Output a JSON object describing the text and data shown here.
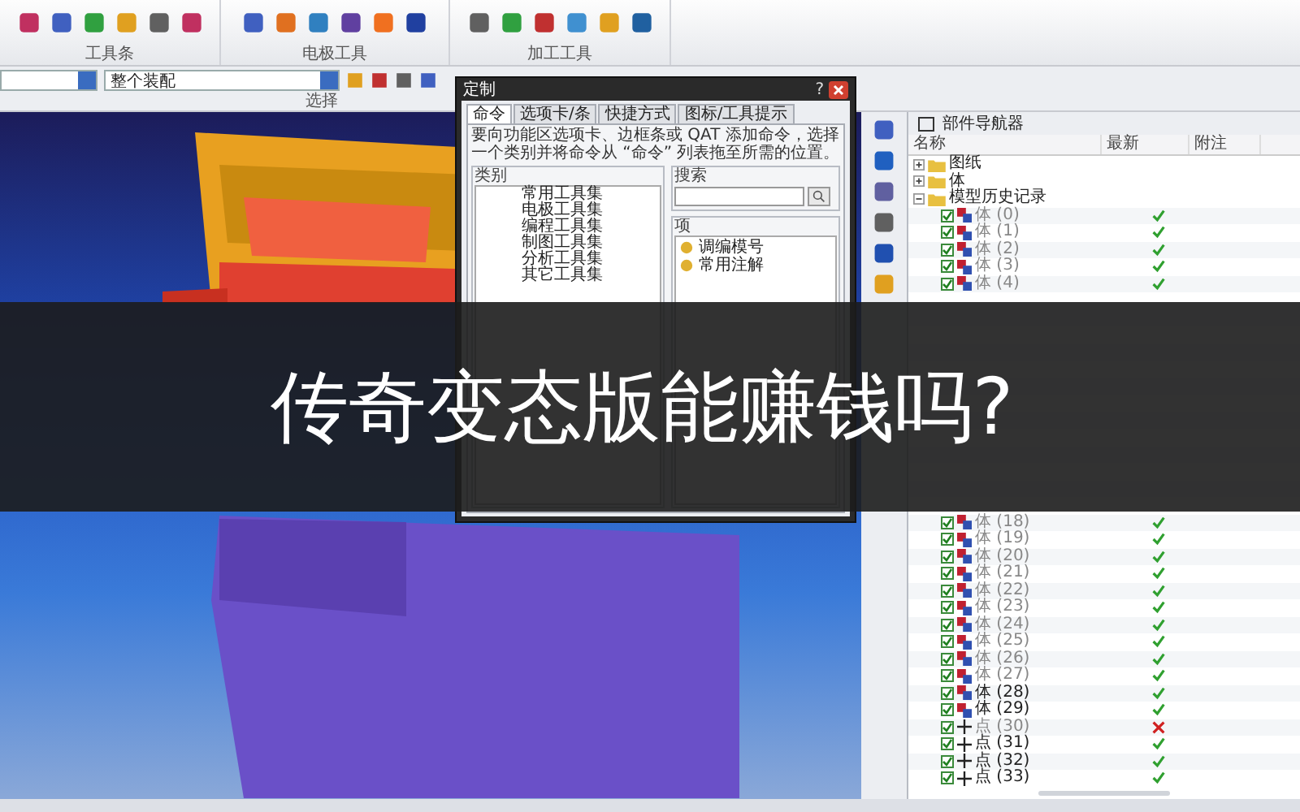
{
  "ribbon": {
    "groups": [
      {
        "label": "工具条"
      },
      {
        "label": "电极工具"
      },
      {
        "label": "加工工具"
      }
    ]
  },
  "selection_bar": {
    "scope": "整个装配",
    "label": "选择"
  },
  "dialog": {
    "title": "定制",
    "help": "?",
    "tabs": [
      {
        "label": "命令",
        "selected": true
      },
      {
        "label": "选项卡/条",
        "selected": false
      },
      {
        "label": "快捷方式",
        "selected": false
      },
      {
        "label": "图标/工具提示",
        "selected": false
      }
    ],
    "description": "要向功能区选项卡、边框条或 QAT 添加命令，选择一个类别并将命令从 “命令” 列表拖至所需的位置。",
    "category": {
      "title": "类别",
      "items": [
        "常用工具集",
        "电极工具集",
        "编程工具集",
        "制图工具集",
        "分析工具集",
        "其它工具集"
      ]
    },
    "search": {
      "title": "搜索"
    },
    "items_group": {
      "title": "项",
      "items": [
        "调编模号",
        "常用注解"
      ]
    }
  },
  "navigator": {
    "title": "部件导航器",
    "columns": [
      "名称",
      "最新",
      "附注"
    ],
    "tree": [
      {
        "label": "图纸",
        "expanded": false
      },
      {
        "label": "体",
        "expanded": false
      },
      {
        "label": "模型历史记录",
        "expanded": true,
        "children": [
          {
            "kind": "body",
            "label": "体 (0)",
            "checked": true,
            "latest": true,
            "greyed": true,
            "selected": false
          },
          {
            "kind": "body",
            "label": "体 (1)",
            "checked": true,
            "latest": true,
            "greyed": true,
            "selected": false
          },
          {
            "kind": "body",
            "label": "体 (2)",
            "checked": true,
            "latest": true,
            "greyed": true,
            "selected": false
          },
          {
            "kind": "body",
            "label": "体 (3)",
            "checked": true,
            "latest": true,
            "greyed": true,
            "selected": false
          },
          {
            "kind": "body",
            "label": "体 (4)",
            "checked": true,
            "latest": true,
            "greyed": true,
            "selected": false
          },
          {
            "kind": "covered"
          },
          {
            "kind": "covered"
          },
          {
            "kind": "covered"
          },
          {
            "kind": "covered"
          },
          {
            "kind": "covered"
          },
          {
            "kind": "covered"
          },
          {
            "kind": "covered"
          },
          {
            "kind": "covered"
          },
          {
            "kind": "covered"
          },
          {
            "kind": "covered"
          },
          {
            "kind": "covered"
          },
          {
            "kind": "covered"
          },
          {
            "kind": "covered"
          },
          {
            "kind": "body",
            "label": "体 (18)",
            "checked": true,
            "latest": true,
            "greyed": true,
            "selected": false
          },
          {
            "kind": "body",
            "label": "体 (19)",
            "checked": true,
            "latest": true,
            "greyed": true,
            "selected": false
          },
          {
            "kind": "body",
            "label": "体 (20)",
            "checked": true,
            "latest": true,
            "greyed": true,
            "selected": false
          },
          {
            "kind": "body",
            "label": "体 (21)",
            "checked": true,
            "latest": true,
            "greyed": true,
            "selected": false
          },
          {
            "kind": "body",
            "label": "体 (22)",
            "checked": true,
            "latest": true,
            "greyed": true,
            "selected": false
          },
          {
            "kind": "body",
            "label": "体 (23)",
            "checked": true,
            "latest": true,
            "greyed": true,
            "selected": false
          },
          {
            "kind": "body",
            "label": "体 (24)",
            "checked": true,
            "latest": true,
            "greyed": true,
            "selected": false
          },
          {
            "kind": "body",
            "label": "体 (25)",
            "checked": true,
            "latest": true,
            "greyed": true,
            "selected": false
          },
          {
            "kind": "body",
            "label": "体 (26)",
            "checked": true,
            "latest": true,
            "greyed": true,
            "selected": false
          },
          {
            "kind": "body",
            "label": "体 (27)",
            "checked": true,
            "latest": true,
            "greyed": true,
            "selected": false
          },
          {
            "kind": "body",
            "label": "体 (28)",
            "checked": true,
            "latest": true,
            "greyed": false,
            "selected": false
          },
          {
            "kind": "body",
            "label": "体 (29)",
            "checked": true,
            "latest": true,
            "greyed": false,
            "selected": false
          },
          {
            "kind": "point",
            "label": "点 (30)",
            "checked": true,
            "latest": false,
            "greyed": true,
            "selected": false
          },
          {
            "kind": "point",
            "label": "点 (31)",
            "checked": true,
            "latest": true,
            "greyed": false,
            "selected": false
          },
          {
            "kind": "point",
            "label": "点 (32)",
            "checked": true,
            "latest": true,
            "greyed": false,
            "selected": false
          },
          {
            "kind": "point",
            "label": "点 (33)",
            "checked": true,
            "latest": true,
            "greyed": false,
            "selected": false
          }
        ]
      }
    ]
  },
  "banner": {
    "text": "传奇变态版能赚钱吗?"
  }
}
